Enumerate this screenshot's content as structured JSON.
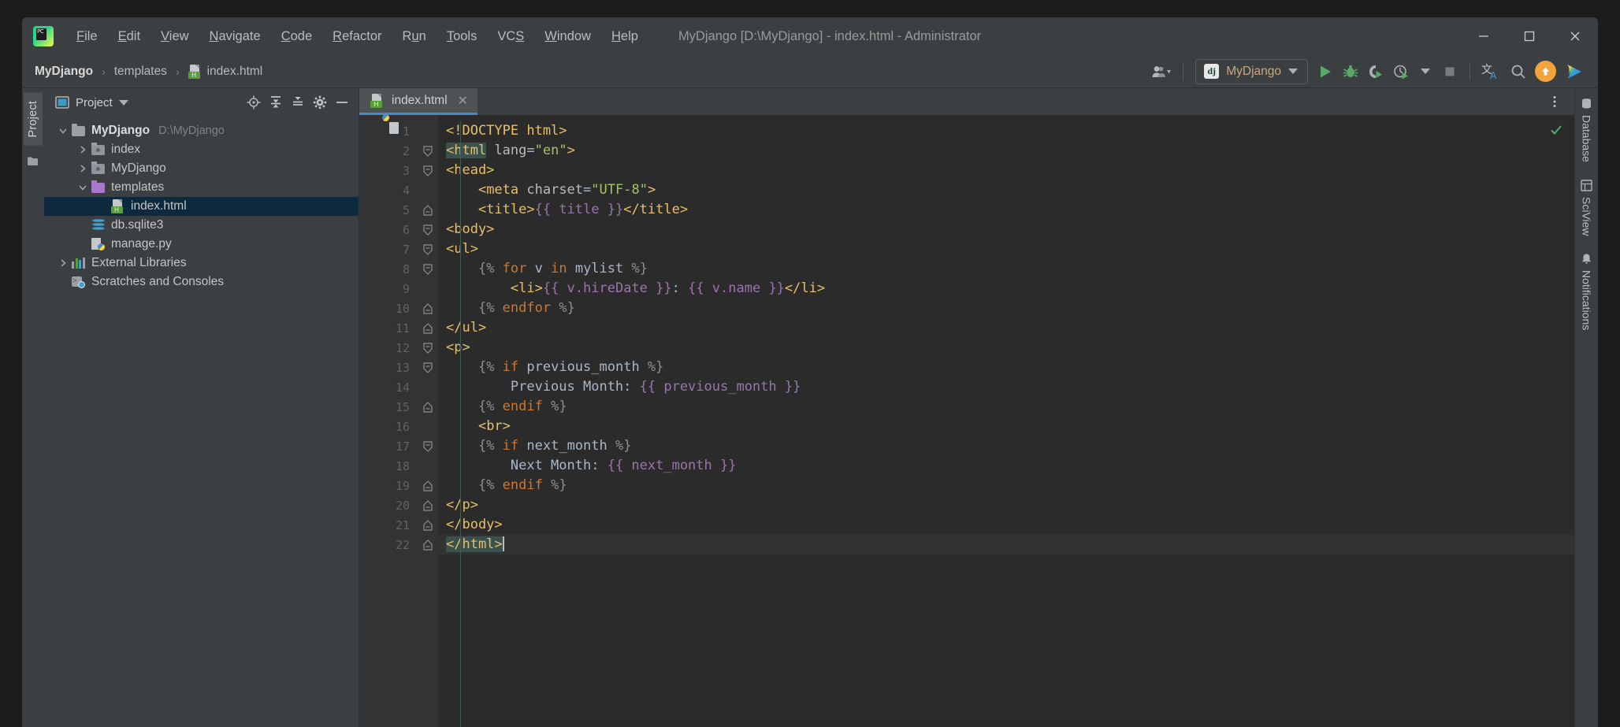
{
  "window": {
    "title": "MyDjango [D:\\MyDjango] - index.html - Administrator",
    "minimize": "minimize-icon",
    "maximize": "maximize-icon",
    "close": "close-icon"
  },
  "menubar": [
    {
      "label": "File",
      "mnemonic": "F"
    },
    {
      "label": "Edit",
      "mnemonic": "E"
    },
    {
      "label": "View",
      "mnemonic": "V"
    },
    {
      "label": "Navigate",
      "mnemonic": "N"
    },
    {
      "label": "Code",
      "mnemonic": "C"
    },
    {
      "label": "Refactor",
      "mnemonic": "R"
    },
    {
      "label": "Run",
      "mnemonic": "u"
    },
    {
      "label": "Tools",
      "mnemonic": "T"
    },
    {
      "label": "VCS",
      "mnemonic": "S"
    },
    {
      "label": "Window",
      "mnemonic": "W"
    },
    {
      "label": "Help",
      "mnemonic": "H"
    }
  ],
  "breadcrumbs": [
    {
      "label": "MyDjango",
      "bold": true
    },
    {
      "label": "templates",
      "bold": false
    },
    {
      "label": "index.html",
      "bold": false,
      "icon": "html-file-icon"
    }
  ],
  "toolbar": {
    "run_config": "MyDjango",
    "run_config_icon": "django-icon",
    "buttons": [
      {
        "name": "run-button",
        "label": "Run"
      },
      {
        "name": "debug-button",
        "label": "Debug"
      },
      {
        "name": "run-coverage-button",
        "label": "Run with Coverage"
      },
      {
        "name": "profile-button",
        "label": "Profile"
      },
      {
        "name": "stop-button",
        "label": "Stop"
      },
      {
        "name": "translate-button",
        "label": "Translate"
      },
      {
        "name": "search-everywhere-button",
        "label": "Search Everywhere"
      },
      {
        "name": "update-button",
        "label": "Update"
      },
      {
        "name": "plugin-button",
        "label": "Plugin"
      }
    ]
  },
  "left_strip": {
    "tab": "Project"
  },
  "project_panel": {
    "title": "Project",
    "actions": [
      "locate-icon",
      "expand-all-icon",
      "collapse-all-icon",
      "settings-icon",
      "hide-icon"
    ],
    "tree": [
      {
        "label": "MyDjango",
        "path": "D:\\MyDjango",
        "icon": "folder-icon",
        "depth": 0,
        "expanded": true,
        "bold": true,
        "selected": false
      },
      {
        "label": "index",
        "path": "",
        "icon": "module-folder-icon",
        "depth": 1,
        "expanded": false,
        "bold": false,
        "selected": false
      },
      {
        "label": "MyDjango",
        "path": "",
        "icon": "module-folder-icon",
        "depth": 1,
        "expanded": false,
        "bold": false,
        "selected": false
      },
      {
        "label": "templates",
        "path": "",
        "icon": "templates-folder-icon",
        "depth": 1,
        "expanded": true,
        "bold": false,
        "selected": false
      },
      {
        "label": "index.html",
        "path": "",
        "icon": "html-file-icon",
        "depth": 2,
        "expanded": null,
        "bold": false,
        "selected": true
      },
      {
        "label": "db.sqlite3",
        "path": "",
        "icon": "database-file-icon",
        "depth": 1,
        "expanded": null,
        "bold": false,
        "selected": false
      },
      {
        "label": "manage.py",
        "path": "",
        "icon": "python-file-icon",
        "depth": 1,
        "expanded": null,
        "bold": false,
        "selected": false
      },
      {
        "label": "External Libraries",
        "path": "",
        "icon": "libraries-icon",
        "depth": 0,
        "expanded": false,
        "bold": false,
        "selected": false
      },
      {
        "label": "Scratches and Consoles",
        "path": "",
        "icon": "scratches-icon",
        "depth": 0,
        "expanded": null,
        "bold": false,
        "selected": false
      }
    ]
  },
  "editor": {
    "tab": {
      "label": "index.html",
      "icon": "html-file-icon",
      "close": "close-icon"
    },
    "more_actions": "more-vertical-icon",
    "inspection_status": "ok-checkmark-icon",
    "caret_line": 22,
    "lines": [
      {
        "n": 1,
        "fold": "",
        "tokens": [
          {
            "t": "tag",
            "v": "<!DOCTYPE html>"
          }
        ]
      },
      {
        "n": 2,
        "fold": "open",
        "tokens": [
          {
            "t": "tag-hl",
            "v": "<html"
          },
          {
            "t": "plain",
            "v": " "
          },
          {
            "t": "attr",
            "v": "lang"
          },
          {
            "t": "plain",
            "v": "="
          },
          {
            "t": "val",
            "v": "\"en\""
          },
          {
            "t": "tag",
            "v": ">"
          }
        ]
      },
      {
        "n": 3,
        "fold": "open",
        "tokens": [
          {
            "t": "tag",
            "v": "<head>"
          }
        ]
      },
      {
        "n": 4,
        "fold": "",
        "tokens": [
          {
            "t": "plain",
            "v": "    "
          },
          {
            "t": "tag",
            "v": "<meta "
          },
          {
            "t": "attr",
            "v": "charset"
          },
          {
            "t": "plain",
            "v": "="
          },
          {
            "t": "val",
            "v": "\"UTF-8\""
          },
          {
            "t": "tag",
            "v": ">"
          }
        ]
      },
      {
        "n": 5,
        "fold": "close",
        "tokens": [
          {
            "t": "plain",
            "v": "    "
          },
          {
            "t": "tag",
            "v": "<title>"
          },
          {
            "t": "dj",
            "v": "{{ title }}"
          },
          {
            "t": "tag",
            "v": "</title>"
          }
        ]
      },
      {
        "n": 6,
        "fold": "open",
        "tokens": [
          {
            "t": "tag",
            "v": "<body>"
          }
        ]
      },
      {
        "n": 7,
        "fold": "open",
        "tokens": [
          {
            "t": "tag",
            "v": "<ul>"
          }
        ]
      },
      {
        "n": 8,
        "fold": "open",
        "tokens": [
          {
            "t": "plain",
            "v": "    "
          },
          {
            "t": "djbr",
            "v": "{% "
          },
          {
            "t": "kw",
            "v": "for"
          },
          {
            "t": "plain",
            "v": " v "
          },
          {
            "t": "kw",
            "v": "in"
          },
          {
            "t": "plain",
            "v": " mylist "
          },
          {
            "t": "djbr",
            "v": "%}"
          }
        ]
      },
      {
        "n": 9,
        "fold": "",
        "tokens": [
          {
            "t": "plain",
            "v": "        "
          },
          {
            "t": "tag",
            "v": "<li>"
          },
          {
            "t": "dj",
            "v": "{{ v.hireDate }}"
          },
          {
            "t": "plain",
            "v": ": "
          },
          {
            "t": "dj",
            "v": "{{ v.name }}"
          },
          {
            "t": "tag",
            "v": "</li>"
          }
        ]
      },
      {
        "n": 10,
        "fold": "close",
        "tokens": [
          {
            "t": "plain",
            "v": "    "
          },
          {
            "t": "djbr",
            "v": "{% "
          },
          {
            "t": "kw",
            "v": "endfor"
          },
          {
            "t": "plain",
            "v": " "
          },
          {
            "t": "djbr",
            "v": "%}"
          }
        ]
      },
      {
        "n": 11,
        "fold": "close",
        "tokens": [
          {
            "t": "tag",
            "v": "</ul>"
          }
        ]
      },
      {
        "n": 12,
        "fold": "open",
        "tokens": [
          {
            "t": "tag",
            "v": "<p>"
          }
        ]
      },
      {
        "n": 13,
        "fold": "open",
        "tokens": [
          {
            "t": "plain",
            "v": "    "
          },
          {
            "t": "djbr",
            "v": "{% "
          },
          {
            "t": "kw",
            "v": "if"
          },
          {
            "t": "plain",
            "v": " previous_month "
          },
          {
            "t": "djbr",
            "v": "%}"
          }
        ]
      },
      {
        "n": 14,
        "fold": "",
        "tokens": [
          {
            "t": "plain",
            "v": "        Previous Month: "
          },
          {
            "t": "dj",
            "v": "{{ previous_month }}"
          }
        ]
      },
      {
        "n": 15,
        "fold": "close",
        "tokens": [
          {
            "t": "plain",
            "v": "    "
          },
          {
            "t": "djbr",
            "v": "{% "
          },
          {
            "t": "kw",
            "v": "endif"
          },
          {
            "t": "plain",
            "v": " "
          },
          {
            "t": "djbr",
            "v": "%}"
          }
        ]
      },
      {
        "n": 16,
        "fold": "",
        "tokens": [
          {
            "t": "plain",
            "v": "    "
          },
          {
            "t": "tag",
            "v": "<br>"
          }
        ]
      },
      {
        "n": 17,
        "fold": "open",
        "tokens": [
          {
            "t": "plain",
            "v": "    "
          },
          {
            "t": "djbr",
            "v": "{% "
          },
          {
            "t": "kw",
            "v": "if"
          },
          {
            "t": "plain",
            "v": " next_month "
          },
          {
            "t": "djbr",
            "v": "%}"
          }
        ]
      },
      {
        "n": 18,
        "fold": "",
        "tokens": [
          {
            "t": "plain",
            "v": "        Next Month: "
          },
          {
            "t": "dj",
            "v": "{{ next_month }}"
          }
        ]
      },
      {
        "n": 19,
        "fold": "close",
        "tokens": [
          {
            "t": "plain",
            "v": "    "
          },
          {
            "t": "djbr",
            "v": "{% "
          },
          {
            "t": "kw",
            "v": "endif"
          },
          {
            "t": "plain",
            "v": " "
          },
          {
            "t": "djbr",
            "v": "%}"
          }
        ]
      },
      {
        "n": 20,
        "fold": "close",
        "tokens": [
          {
            "t": "tag",
            "v": "</p>"
          }
        ]
      },
      {
        "n": 21,
        "fold": "close",
        "tokens": [
          {
            "t": "tag",
            "v": "</body>"
          }
        ]
      },
      {
        "n": 22,
        "fold": "close",
        "tokens": [
          {
            "t": "tag-hl",
            "v": "</html>"
          },
          {
            "t": "caret",
            "v": ""
          }
        ]
      }
    ]
  },
  "right_strip": [
    {
      "label": "Database",
      "icon": "database-icon"
    },
    {
      "label": "SciView",
      "icon": "sciview-icon"
    },
    {
      "label": "Notifications",
      "icon": "notifications-icon"
    }
  ],
  "colors": {
    "accent_blue": "#4a88c7",
    "selection": "#0d293e",
    "editor_bg": "#2b2b2b",
    "panel_bg": "#3c3f41",
    "tag": "#e8bf6a",
    "value": "#a5c261",
    "django_var": "#9876aa",
    "keyword": "#cc7832",
    "update_orange": "#f2a33c",
    "run_green": "#59a869"
  }
}
